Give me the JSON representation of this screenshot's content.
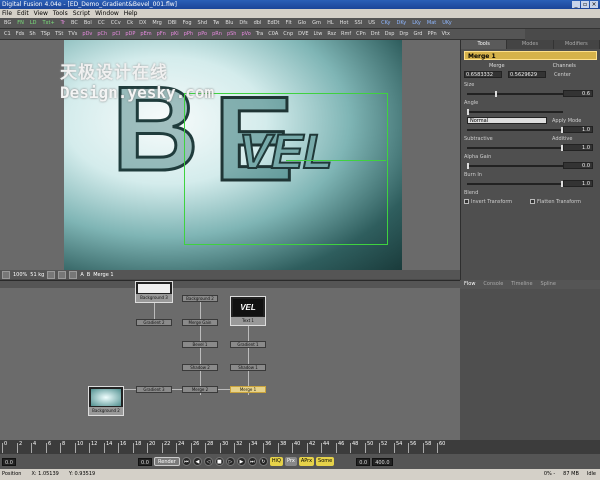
{
  "window": {
    "title": "Digital Fusion 4.04e - [ED_Demo_Gradient&Bevel_001.flw]",
    "controls": [
      "_",
      "▫",
      "×"
    ]
  },
  "menu": [
    "File",
    "Edit",
    "View",
    "Tools",
    "Script",
    "Window",
    "Help"
  ],
  "toolbar1": {
    "buttons": [
      {
        "label": "BG",
        "color": "#e0e0e0"
      },
      {
        "label": "FN",
        "color": "#7be07b"
      },
      {
        "label": "LD",
        "color": "#7be07b"
      },
      {
        "label": "Txt+",
        "color": "#7be07b"
      },
      {
        "label": "Tr",
        "color": "#e889e0"
      },
      {
        "label": "BC",
        "color": "#e0e0e0"
      },
      {
        "label": "Bol",
        "color": "#e0e0e0"
      },
      {
        "label": "CC",
        "color": "#e0e0e0"
      },
      {
        "label": "CCv",
        "color": "#e0e0e0"
      },
      {
        "label": "Ck",
        "color": "#e0e0e0"
      },
      {
        "label": "DX",
        "color": "#e0e0e0"
      },
      {
        "label": "Mrg",
        "color": "#e0e0e0"
      },
      {
        "label": "DBI",
        "color": "#e0e0e0"
      },
      {
        "label": "Fog",
        "color": "#e0e0e0"
      },
      {
        "label": "Shd",
        "color": "#e0e0e0"
      },
      {
        "label": "Tw",
        "color": "#e0e0e0"
      },
      {
        "label": "Blu",
        "color": "#e0e0e0"
      },
      {
        "label": "Dfs",
        "color": "#e0e0e0"
      },
      {
        "label": "dbl",
        "color": "#e0e0e0"
      },
      {
        "label": "EdDt",
        "color": "#e0e0e0"
      },
      {
        "label": "Flt",
        "color": "#e0e0e0"
      },
      {
        "label": "Glo",
        "color": "#e0e0e0"
      },
      {
        "label": "Grn",
        "color": "#e0e0e0"
      },
      {
        "label": "HL",
        "color": "#e0e0e0"
      },
      {
        "label": "Hot",
        "color": "#e0e0e0"
      },
      {
        "label": "SSI",
        "color": "#e0e0e0"
      },
      {
        "label": "US",
        "color": "#e0e0e0"
      },
      {
        "label": "CKy",
        "color": "#8fb7ff"
      },
      {
        "label": "DKy",
        "color": "#8fb7ff"
      },
      {
        "label": "LKy",
        "color": "#8fb7ff"
      },
      {
        "label": "Mat",
        "color": "#8fb7ff"
      },
      {
        "label": "UKy",
        "color": "#8fb7ff"
      }
    ]
  },
  "toolbar2": {
    "buttons": [
      {
        "label": "C1",
        "color": "#e0e0e0"
      },
      {
        "label": "Fds",
        "color": "#e0e0e0"
      },
      {
        "label": "Sh",
        "color": "#e0e0e0"
      },
      {
        "label": "TSp",
        "color": "#e0e0e0"
      },
      {
        "label": "TSt",
        "color": "#e0e0e0"
      },
      {
        "label": "TVs",
        "color": "#e0e0e0"
      },
      {
        "label": "pDv",
        "color": "#e889e0"
      },
      {
        "label": "pCh",
        "color": "#e889e0"
      },
      {
        "label": "pCI",
        "color": "#e889e0"
      },
      {
        "label": "pDP",
        "color": "#e889e0"
      },
      {
        "label": "pEm",
        "color": "#e889e0"
      },
      {
        "label": "pFn",
        "color": "#e889e0"
      },
      {
        "label": "pKi",
        "color": "#e889e0"
      },
      {
        "label": "pPh",
        "color": "#e889e0"
      },
      {
        "label": "pPo",
        "color": "#e889e0"
      },
      {
        "label": "pRn",
        "color": "#e889e0"
      },
      {
        "label": "pSh",
        "color": "#e889e0"
      },
      {
        "label": "pVo",
        "color": "#e889e0"
      },
      {
        "label": "Tra",
        "color": "#e0e0e0"
      },
      {
        "label": "C0A",
        "color": "#e0e0e0"
      },
      {
        "label": "Cnp",
        "color": "#e0e0e0"
      },
      {
        "label": "DVE",
        "color": "#e0e0e0"
      },
      {
        "label": "Ltw",
        "color": "#e0e0e0"
      },
      {
        "label": "Rsz",
        "color": "#e0e0e0"
      },
      {
        "label": "Rmf",
        "color": "#e0e0e0"
      },
      {
        "label": "CPn",
        "color": "#e0e0e0"
      },
      {
        "label": "Dnt",
        "color": "#e0e0e0"
      },
      {
        "label": "Dsp",
        "color": "#e0e0e0"
      },
      {
        "label": "Drp",
        "color": "#e0e0e0"
      },
      {
        "label": "Grd",
        "color": "#e0e0e0"
      },
      {
        "label": "PPn",
        "color": "#e0e0e0"
      },
      {
        "label": "Vtx",
        "color": "#e0e0e0"
      }
    ]
  },
  "viewer": {
    "watermark_cn": "天极设计在线",
    "watermark_en": "Design.yesky.com",
    "letters": [
      "B",
      "E",
      "VEL"
    ],
    "bar": {
      "zoom": "100%",
      "size": "51 kg",
      "flags": [
        "A",
        "B"
      ],
      "tool": "Merge 1"
    }
  },
  "panel": {
    "tabs": [
      "Tools",
      "Modes",
      "Modifiers"
    ],
    "tool_name": "Merge 1",
    "subtabs": [
      "Merge",
      "Channels"
    ],
    "center_label": "Center",
    "center_x": "0.6583332",
    "center_y": "0.5629629",
    "size_label": "Size",
    "size_value": "0.6",
    "angle_label": "Angle",
    "apply_mode_value": "Normal",
    "apply_mode_label": "Apply Mode",
    "apply_mode_num": "1.0",
    "subtractive_label": "Subtractive",
    "additive_label": "Additive",
    "subadd_value": "1.0",
    "alpha_gain_label": "Alpha Gain",
    "alpha_gain_value": "0.0",
    "burn_in_label": "Burn In",
    "burn_in_value": "1.0",
    "blend_label": "Blend",
    "invert_label": "Invert Transform",
    "flatten_label": "Flatten Transform"
  },
  "flow": {
    "tabs": [
      "Flow",
      "Console",
      "Timeline",
      "Spline"
    ],
    "nodes": {
      "background3": "Background 3",
      "background2_top": "Background 2",
      "gradient2": "Gradient 2",
      "merge_gain": "Merge Gain",
      "bevel1": "Bevel 1",
      "shadow2": "Shadow 2",
      "merge2": "Merge 2",
      "gradient3": "Gradient 3",
      "background2": "Background 2",
      "text1": "Text 1",
      "vel_label": "VEL",
      "gradient1": "Gradient 1",
      "shadow1": "Shadow 1",
      "merge1": "Merge 1"
    }
  },
  "timeline": {
    "ticks": [
      "0",
      "2",
      "4",
      "6",
      "8",
      "10",
      "12",
      "14",
      "16",
      "18",
      "20",
      "22",
      "24",
      "26",
      "28",
      "30",
      "32",
      "34",
      "36",
      "38",
      "40",
      "42",
      "44",
      "46",
      "48",
      "50",
      "52",
      "54",
      "56",
      "58",
      "60"
    ]
  },
  "transport": {
    "start": "0.0",
    "current": "0.0",
    "render": "Render",
    "hiq": "HiQ",
    "prx": "Prx",
    "aprx": "APrx",
    "some": "Some",
    "end_current": "0.0",
    "end": "400.0"
  },
  "status": {
    "position_label": "Position",
    "x": "X: 1.05139",
    "y": "Y: 0.93519",
    "mem_pct": "0% - ",
    "mem": "87 MB",
    "idle": "Idle"
  }
}
